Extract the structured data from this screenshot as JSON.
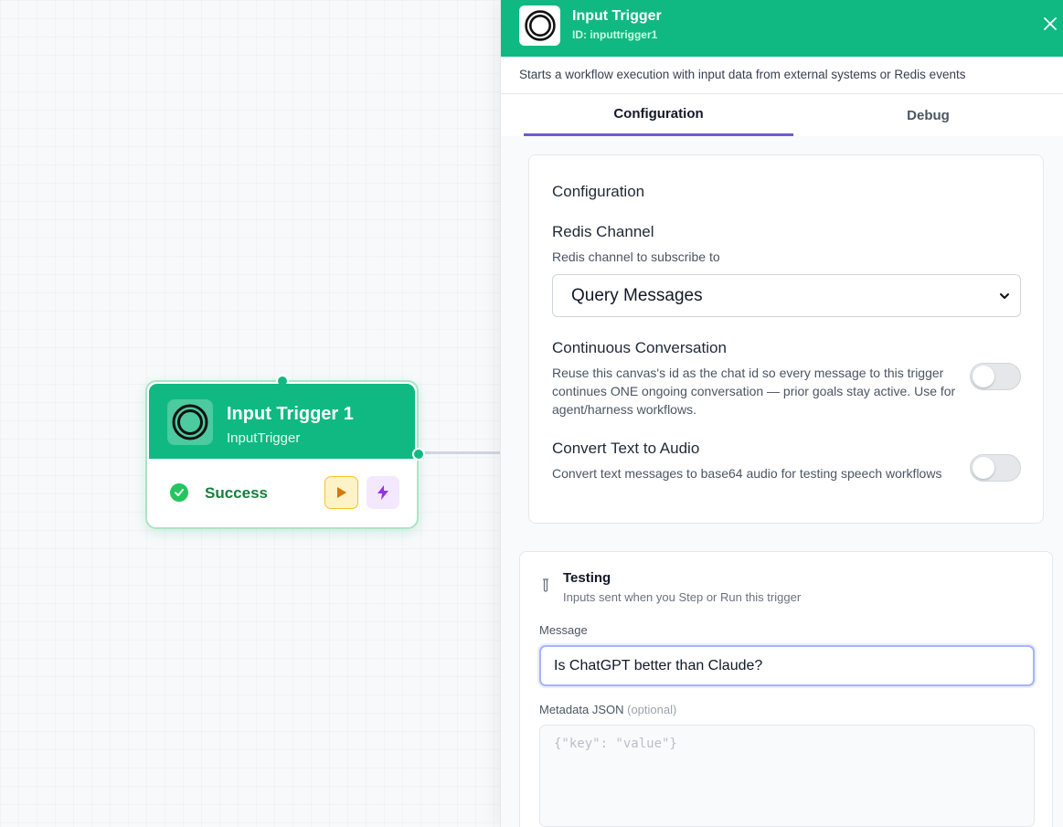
{
  "canvas": {
    "node": {
      "title": "Input Trigger 1",
      "subtitle": "InputTrigger",
      "status": "Success",
      "icon": "circle-logo-icon",
      "color": "#10b981"
    }
  },
  "panel": {
    "title": "Input Trigger",
    "id_text": "ID: inputtrigger1",
    "description": "Starts a workflow execution with input data from external systems or Redis events",
    "tabs": [
      {
        "label": "Configuration",
        "active": true
      },
      {
        "label": "Debug",
        "active": false
      }
    ],
    "config": {
      "heading": "Configuration",
      "redis_channel": {
        "label": "Redis Channel",
        "help": "Redis channel to subscribe to",
        "selected": "Query Messages"
      },
      "continuous_conversation": {
        "label": "Continuous Conversation",
        "help": "Reuse this canvas's id as the chat id so every message to this trigger continues ONE ongoing conversation — prior goals stay active. Use for agent/harness workflows.",
        "enabled": false
      },
      "text_to_audio": {
        "label": "Convert Text to Audio",
        "help": "Convert text messages to base64 audio for testing speech workflows",
        "enabled": false
      }
    },
    "testing": {
      "title": "Testing",
      "subtitle": "Inputs sent when you Step or Run this trigger",
      "message_label": "Message",
      "message_value": "Is ChatGPT better than Claude?",
      "metadata_label": "Metadata JSON",
      "metadata_optional": "(optional)",
      "metadata_placeholder": "{\"key\": \"value\"}"
    }
  }
}
